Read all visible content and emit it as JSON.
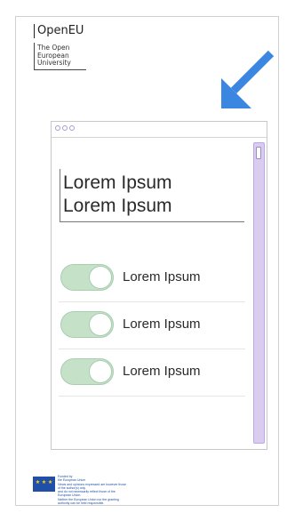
{
  "logo": {
    "name": "OpenEU",
    "subtitle_lines": [
      "The Open",
      "European",
      "University"
    ]
  },
  "window": {
    "heading_lines": [
      "Lorem Ipsum",
      "Lorem Ipsum"
    ],
    "toggles": [
      {
        "label": "Lorem Ipsum",
        "state": "on"
      },
      {
        "label": "Lorem Ipsum",
        "state": "on"
      },
      {
        "label": "Lorem Ipsum",
        "state": "on"
      }
    ]
  },
  "funding": {
    "text_lines": [
      "Funded by",
      "the European Union",
      "Views and opinions expressed are however those of the author(s) only",
      "and do not necessarily reflect those of the European Union.",
      "Neither the European Union nor the granting authority can be held responsible."
    ]
  },
  "colors": {
    "arrow": "#3b86e0",
    "toggle_fill": "#c5e2c9",
    "scrollbar": "#d9ccf0",
    "window_dots": "#a99ad3",
    "eu_flag": "#1f4fa8"
  },
  "icons": {
    "arrow": "arrow-down-left-icon",
    "flag": "eu-flag-icon"
  }
}
